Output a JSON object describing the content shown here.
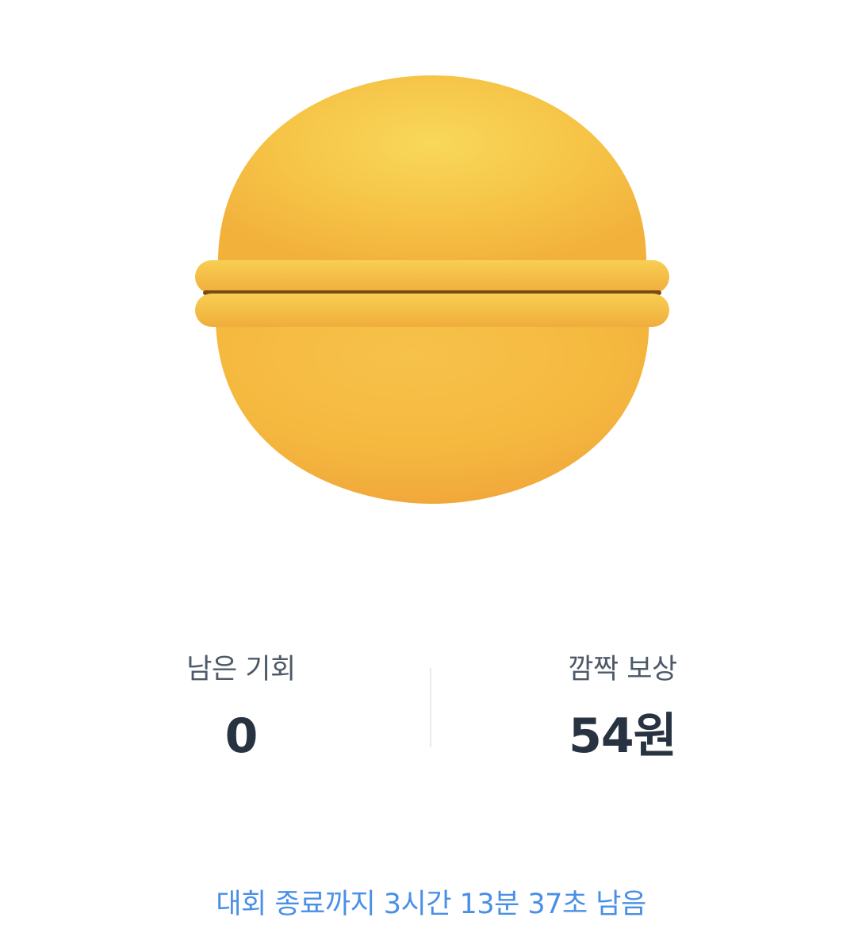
{
  "capsule": {
    "icon": "capsule-toy-icon",
    "colors": {
      "highlight": "#f8d85a",
      "body": "#f5b93c",
      "shadow": "#f0a53a",
      "seam": "#7a4a12"
    }
  },
  "stats": {
    "remaining_label": "남은 기회",
    "remaining_value": "0",
    "reward_label": "깜짝 보상",
    "reward_value": "54원"
  },
  "footer": {
    "timer_text": "대회 종료까지 3시간 13분 37초 남음",
    "timer_color": "#4a8fe7"
  }
}
